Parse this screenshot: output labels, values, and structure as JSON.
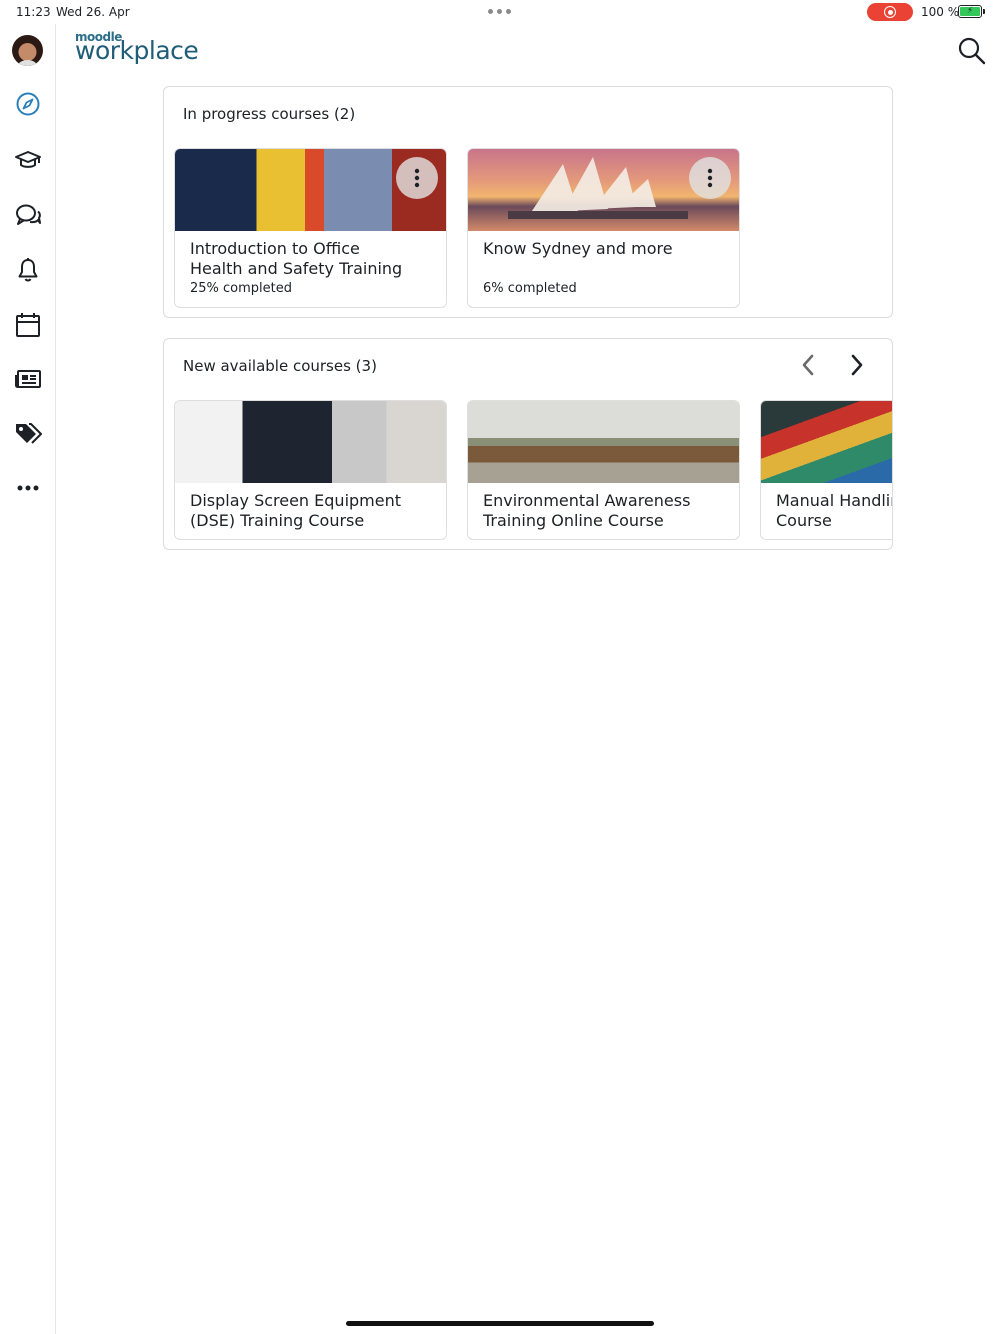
{
  "status_bar": {
    "time": "11:23",
    "date": "Wed 26. Apr",
    "battery": "100 %"
  },
  "header": {
    "logo_top": "moodle",
    "logo_main": "workplace"
  },
  "sidebar": {
    "items": [
      {
        "name": "avatar"
      },
      {
        "name": "compass-icon"
      },
      {
        "name": "graduation-cap-icon"
      },
      {
        "name": "chat-bubbles-icon"
      },
      {
        "name": "bell-icon"
      },
      {
        "name": "calendar-icon"
      },
      {
        "name": "news-icon"
      },
      {
        "name": "tags-icon"
      },
      {
        "name": "more-icon"
      }
    ]
  },
  "in_progress": {
    "title": "In progress courses (2)",
    "courses": [
      {
        "name": "Introduction to Office\nHealth and Safety Training",
        "progress": "25% completed",
        "progress_value": 25
      },
      {
        "name": "Know Sydney and more",
        "progress": "6% completed",
        "progress_value": 6
      }
    ]
  },
  "new_courses": {
    "title": "New available courses (3)",
    "courses": [
      {
        "name": "Display Screen Equipment\n(DSE) Training Course"
      },
      {
        "name": "Environmental Awareness\nTraining Online Course"
      },
      {
        "name": "Manual Handling\nCourse"
      }
    ]
  },
  "colors": {
    "accent": "#2c7fb8",
    "brand": "#1f5d78",
    "record": "#ea4335",
    "battery": "#34c759"
  }
}
